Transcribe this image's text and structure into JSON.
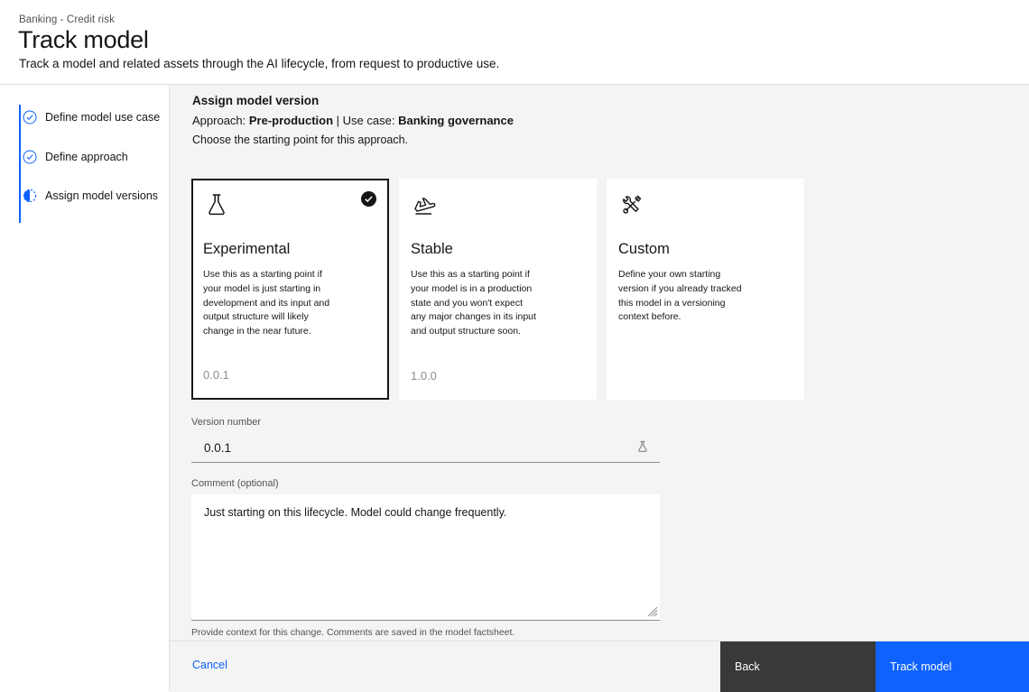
{
  "header": {
    "breadcrumb": "Banking - Credit risk",
    "title": "Track model",
    "subtitle": "Track a model and related assets through the AI lifecycle, from request to productive use."
  },
  "sidebar": {
    "steps": [
      {
        "label": "Define model use case",
        "state": "complete",
        "icon": "check-circle-icon"
      },
      {
        "label": "Define approach",
        "state": "complete",
        "icon": "check-circle-icon"
      },
      {
        "label": "Assign model versions",
        "state": "current",
        "icon": "half-circle-icon"
      }
    ]
  },
  "main": {
    "title": "Assign model version",
    "approach_prefix": "Approach: ",
    "approach_value": "Pre-production",
    "separator": " | ",
    "usecase_prefix": "Use case: ",
    "usecase_value": "Banking governance",
    "instruction": "Choose the starting point for this approach.",
    "cards": [
      {
        "icon": "flask-icon",
        "title": "Experimental",
        "description": "Use this as a starting point if your model is just starting in development and its input and output structure will likely change in the near future.",
        "version": "0.0.1",
        "selected": true
      },
      {
        "icon": "plane-takeoff-icon",
        "title": "Stable",
        "description": "Use this as a starting point if your model is in a production state and you won't expect any major changes in its input and output structure soon.",
        "version": "1.0.0",
        "selected": false
      },
      {
        "icon": "tools-icon",
        "title": "Custom",
        "description": "Define your own starting version if you already tracked this model in a versioning context before.",
        "version": "",
        "selected": false
      }
    ],
    "version_field": {
      "label": "Version number",
      "value": "0.0.1",
      "icon": "flask-icon"
    },
    "comment_field": {
      "label": "Comment (optional)",
      "value": "Just starting on this lifecycle. Model could change frequently.",
      "placeholder": "",
      "helper": "Provide context for this change. Comments are saved in the model factsheet."
    }
  },
  "footer": {
    "cancel_label": "Cancel",
    "back_label": "Back",
    "primary_label": "Track model"
  },
  "colors": {
    "accent": "#0f62fe",
    "dark_button": "#393939",
    "panel_bg": "#f4f4f4",
    "border": "#e0e0e0",
    "muted_text": "#525252"
  }
}
